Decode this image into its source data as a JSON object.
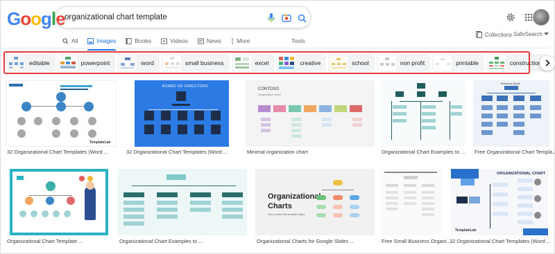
{
  "logo": {
    "g1": "G",
    "o1": "o",
    "o2": "o",
    "g2": "g",
    "l": "l",
    "e": "e"
  },
  "search": {
    "value": "organizational chart template",
    "placeholder": ""
  },
  "tabs": [
    {
      "label": "All",
      "icon": "search-icon"
    },
    {
      "label": "Images",
      "icon": "image-icon",
      "active": true
    },
    {
      "label": "Books",
      "icon": "book-icon"
    },
    {
      "label": "Videos",
      "icon": "video-icon"
    },
    {
      "label": "News",
      "icon": "news-icon"
    },
    {
      "label": "More",
      "icon": "more-vert-icon"
    }
  ],
  "tools_label": "Tools",
  "collections_label": "Collections",
  "safesearch_label": "SafeSearch",
  "chips": [
    {
      "label": "editable"
    },
    {
      "label": "powerpoint"
    },
    {
      "label": "word"
    },
    {
      "label": "small business"
    },
    {
      "label": "excel"
    },
    {
      "label": "creative"
    },
    {
      "label": "school"
    },
    {
      "label": "non profit"
    },
    {
      "label": "printable"
    },
    {
      "label": "construction"
    }
  ],
  "results": [
    {
      "caption": "32 Organizational Chart Templates (Word ..."
    },
    {
      "caption": "32 Organizational Chart Templates (Word ..."
    },
    {
      "caption": "Minimal organization chart"
    },
    {
      "caption": "Organizational Chart Examples to ..."
    },
    {
      "caption": "Free Organizational Chart Templa..."
    },
    {
      "caption": "Organizational Chart Template ..."
    },
    {
      "caption": "Organizational Chart Examples to ..."
    },
    {
      "caption": "Organizational Charts for Google Slides ..."
    },
    {
      "caption": "Free Small Business Organi..."
    },
    {
      "caption": "32 Organizational Chart Templates (Word ..."
    }
  ],
  "thumb_text": {
    "t2_title": "BOARD OF DIRECTORS",
    "t3_title": "CONTOSO",
    "t3_sub": "Organization chart",
    "t5_title": "Business Name",
    "t8_title": "Organizational",
    "t8_title2": "Charts",
    "t8_sub": "Here is where this template begins",
    "t10_title": "ORGANIZATIONAL CHART",
    "t1_brand": "TemplateLab",
    "t10_brand": "TemplateLab"
  },
  "colors": {
    "accent": "#1a73e8",
    "highlight": "#e33b3b"
  }
}
